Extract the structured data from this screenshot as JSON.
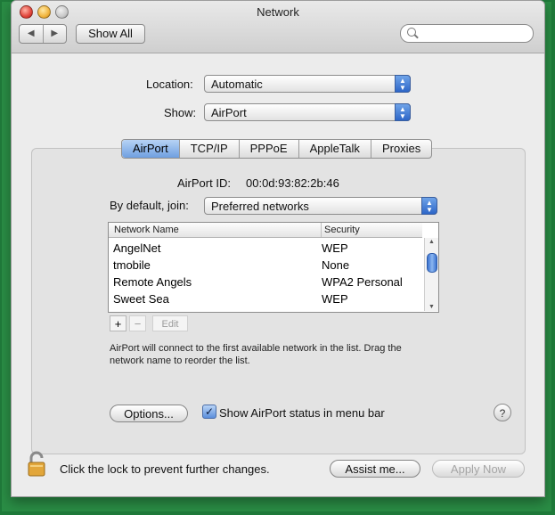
{
  "window": {
    "title": "Network"
  },
  "toolbar": {
    "back_icon": "◀",
    "forward_icon": "▶",
    "show_all_label": "Show All",
    "search_placeholder": ""
  },
  "location": {
    "label": "Location:",
    "value": "Automatic"
  },
  "show": {
    "label": "Show:",
    "value": "AirPort"
  },
  "tabs": [
    {
      "label": "AirPort",
      "selected": true
    },
    {
      "label": "TCP/IP",
      "selected": false
    },
    {
      "label": "PPPoE",
      "selected": false
    },
    {
      "label": "AppleTalk",
      "selected": false
    },
    {
      "label": "Proxies",
      "selected": false
    }
  ],
  "airport": {
    "id_label": "AirPort ID:",
    "id_value": "00:0d:93:82:2b:46",
    "join_label": "By default, join:",
    "join_value": "Preferred networks"
  },
  "networks": {
    "headers": {
      "name": "Network Name",
      "security": "Security"
    },
    "rows": [
      {
        "name": "AngelNet",
        "security": "WEP"
      },
      {
        "name": "tmobile",
        "security": "None"
      },
      {
        "name": "Remote Angels",
        "security": "WPA2 Personal"
      },
      {
        "name": "Sweet Sea",
        "security": "WEP"
      }
    ],
    "add_label": "+",
    "remove_label": "−",
    "edit_label": "Edit"
  },
  "help_text": {
    "line1": "AirPort will connect to the first available network in the list. Drag the",
    "line2": "network name to reorder the list."
  },
  "options_label": "Options...",
  "menu_status": {
    "label": "Show AirPort status in menu bar",
    "checked": true,
    "check_glyph": "✓"
  },
  "help_button_label": "?",
  "footer": {
    "lock_text": "Click the lock to prevent further changes.",
    "assist_label": "Assist me...",
    "apply_label": "Apply Now"
  },
  "colors": {
    "accent": "#3b73d1",
    "window_bg": "#ececec",
    "outer_frame": "#1f7a3a"
  }
}
